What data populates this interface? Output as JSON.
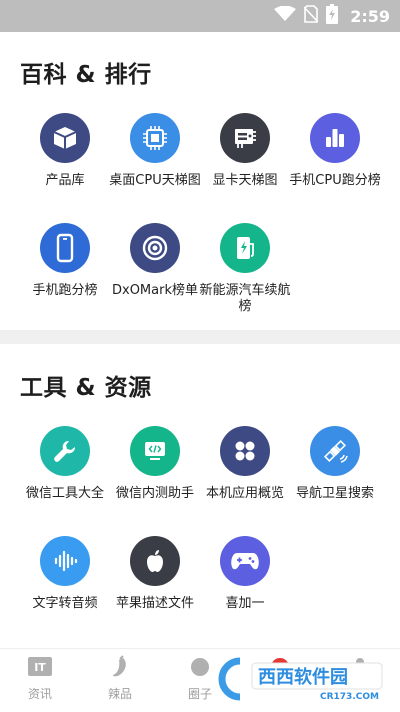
{
  "status_bar": {
    "time": "2:59"
  },
  "sections": [
    {
      "title": "百科 & 排行",
      "items": [
        {
          "label": "产品库",
          "icon": "box-icon",
          "color": "#3d4a83"
        },
        {
          "label": "桌面CPU天梯图",
          "icon": "cpu-icon",
          "color": "#3a8ee6"
        },
        {
          "label": "显卡天梯图",
          "icon": "gpu-card-icon",
          "color": "#3a3d45"
        },
        {
          "label": "手机CPU跑分榜",
          "icon": "bar-chart-icon",
          "color": "#5b5fe0"
        },
        {
          "label": "手机跑分榜",
          "icon": "phone-icon",
          "color": "#2e6bd6"
        },
        {
          "label": "DxOMark榜单",
          "icon": "camera-lens-icon",
          "color": "#3d4a83"
        },
        {
          "label": "新能源汽车续航榜",
          "icon": "charging-station-icon",
          "color": "#14b58a"
        }
      ]
    },
    {
      "title": "工具 & 资源",
      "items": [
        {
          "label": "微信工具大全",
          "icon": "wrench-icon",
          "color": "#1fb8a8"
        },
        {
          "label": "微信内测助手",
          "icon": "code-window-icon",
          "color": "#14b58a"
        },
        {
          "label": "本机应用概览",
          "icon": "apps-grid-icon",
          "color": "#3d4a83"
        },
        {
          "label": "导航卫星搜索",
          "icon": "satellite-icon",
          "color": "#3a8ee6"
        },
        {
          "label": "文字转音频",
          "icon": "audio-wave-icon",
          "color": "#3a9cf0"
        },
        {
          "label": "苹果描述文件",
          "icon": "apple-icon",
          "color": "#3a3d45"
        },
        {
          "label": "喜加一",
          "icon": "gamepad-icon",
          "color": "#5b5fe0"
        }
      ]
    }
  ],
  "bottom_nav": [
    {
      "label": "资讯",
      "icon": "it-news-icon"
    },
    {
      "label": "辣品",
      "icon": "chili-icon"
    },
    {
      "label": "圈子",
      "icon": "circle-icon"
    },
    {
      "label": "",
      "icon": "red-badge-icon"
    },
    {
      "label": "",
      "icon": "person-icon"
    }
  ],
  "watermark": {
    "main": "西西软件园",
    "sub": "CR173.COM"
  }
}
